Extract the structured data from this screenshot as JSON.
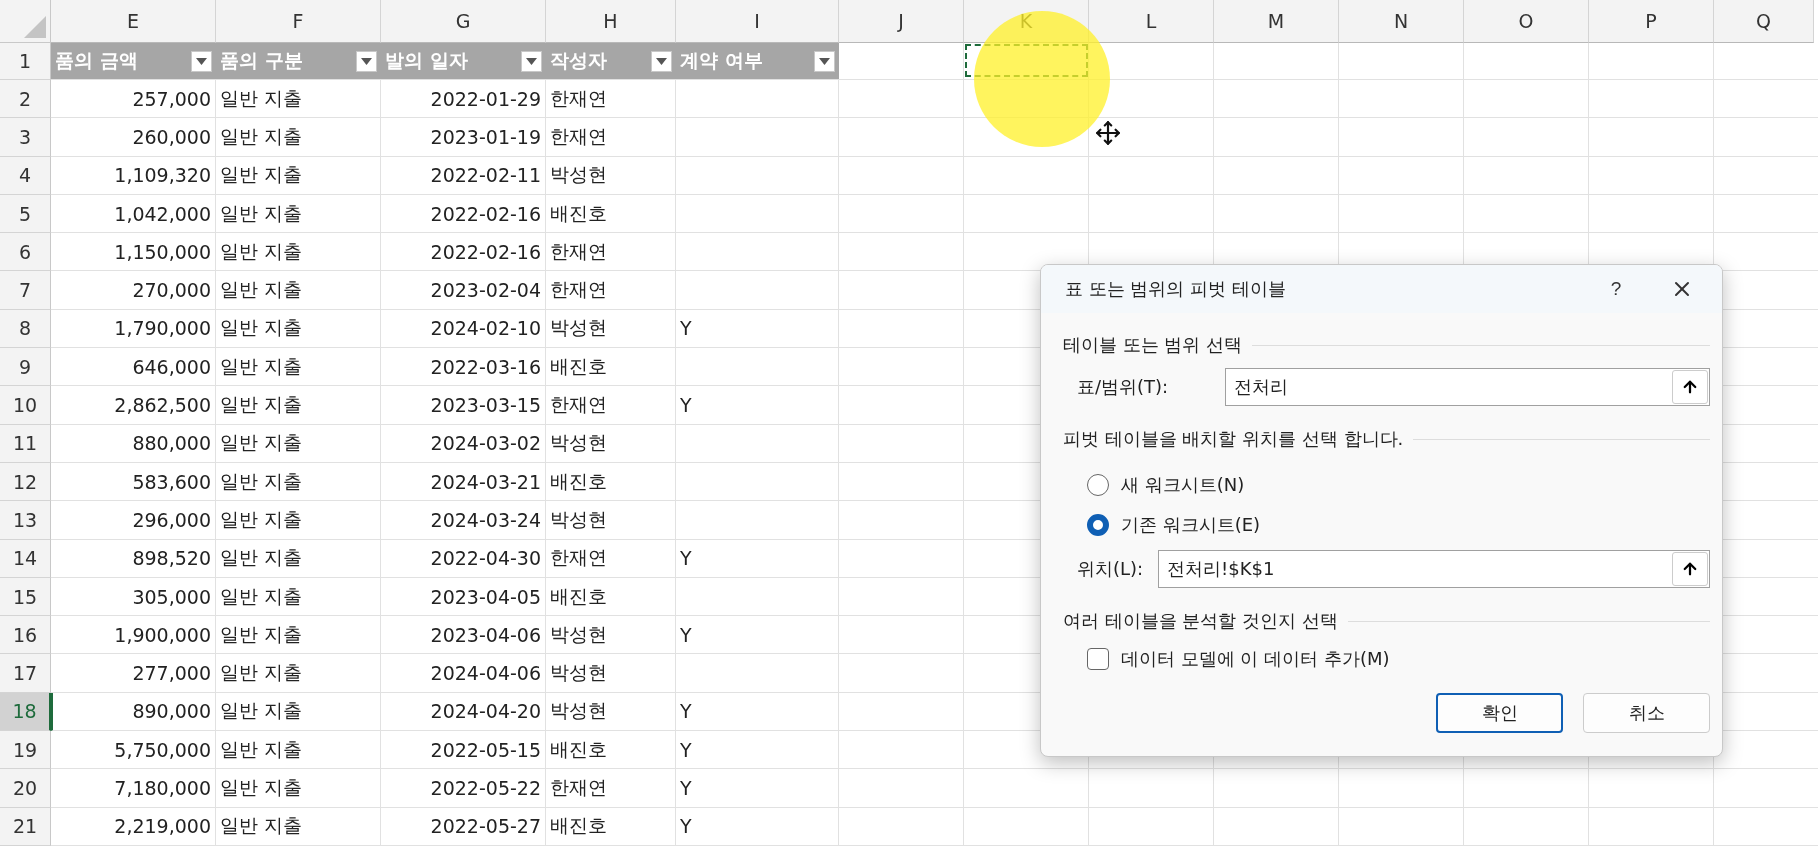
{
  "columns": [
    {
      "label": "E"
    },
    {
      "label": "F"
    },
    {
      "label": "G"
    },
    {
      "label": "H"
    },
    {
      "label": "I"
    },
    {
      "label": "J"
    },
    {
      "label": "K"
    },
    {
      "label": "L"
    },
    {
      "label": "M"
    },
    {
      "label": "N"
    },
    {
      "label": "O"
    },
    {
      "label": "P"
    },
    {
      "label": "Q"
    }
  ],
  "header_row": {
    "num": "1",
    "marquee": true,
    "headers": [
      "품의 금액",
      "품의 구분",
      "발의 일자",
      "작성자",
      "계약 여부"
    ]
  },
  "rows": [
    {
      "num": "2",
      "amount": "257,000",
      "category": "일반 지출",
      "date": "2022-01-29",
      "author": "한재연",
      "selected": false
    },
    {
      "num": "3",
      "amount": "260,000",
      "category": "일반 지출",
      "date": "2023-01-19",
      "author": "한재연",
      "selected": false
    },
    {
      "num": "4",
      "amount": "1,109,320",
      "category": "일반 지출",
      "date": "2022-02-11",
      "author": "박성현",
      "selected": false
    },
    {
      "num": "5",
      "amount": "1,042,000",
      "category": "일반 지출",
      "date": "2022-02-16",
      "author": "배진호",
      "selected": false
    },
    {
      "num": "6",
      "amount": "1,150,000",
      "category": "일반 지출",
      "date": "2022-02-16",
      "author": "한재연",
      "selected": false
    },
    {
      "num": "7",
      "amount": "270,000",
      "category": "일반 지출",
      "date": "2023-02-04",
      "author": "한재연",
      "selected": false
    },
    {
      "num": "8",
      "amount": "1,790,000",
      "category": "일반 지출",
      "date": "2024-02-10",
      "author": "박성현",
      "contract": "Y",
      "selected": false
    },
    {
      "num": "9",
      "amount": "646,000",
      "category": "일반 지출",
      "date": "2022-03-16",
      "author": "배진호",
      "selected": false
    },
    {
      "num": "10",
      "amount": "2,862,500",
      "category": "일반 지출",
      "date": "2023-03-15",
      "author": "한재연",
      "contract": "Y",
      "selected": false
    },
    {
      "num": "11",
      "amount": "880,000",
      "category": "일반 지출",
      "date": "2024-03-02",
      "author": "박성현",
      "selected": false
    },
    {
      "num": "12",
      "amount": "583,600",
      "category": "일반 지출",
      "date": "2024-03-21",
      "author": "배진호",
      "selected": false
    },
    {
      "num": "13",
      "amount": "296,000",
      "category": "일반 지출",
      "date": "2024-03-24",
      "author": "박성현",
      "selected": false
    },
    {
      "num": "14",
      "amount": "898,520",
      "category": "일반 지출",
      "date": "2022-04-30",
      "author": "한재연",
      "contract": "Y",
      "selected": false
    },
    {
      "num": "15",
      "amount": "305,000",
      "category": "일반 지출",
      "date": "2023-04-05",
      "author": "배진호",
      "selected": false
    },
    {
      "num": "16",
      "amount": "1,900,000",
      "category": "일반 지출",
      "date": "2023-04-06",
      "author": "박성현",
      "contract": "Y",
      "selected": false
    },
    {
      "num": "17",
      "amount": "277,000",
      "category": "일반 지출",
      "date": "2024-04-06",
      "author": "박성현",
      "selected": false
    },
    {
      "num": "18",
      "amount": "890,000",
      "category": "일반 지출",
      "date": "2024-04-20",
      "author": "박성현",
      "contract": "Y",
      "selected": true
    },
    {
      "num": "19",
      "amount": "5,750,000",
      "category": "일반 지출",
      "date": "2022-05-15",
      "author": "배진호",
      "contract": "Y",
      "selected": false
    },
    {
      "num": "20",
      "amount": "7,180,000",
      "category": "일반 지출",
      "date": "2022-05-22",
      "author": "한재연",
      "contract": "Y",
      "selected": false
    },
    {
      "num": "21",
      "amount": "2,219,000",
      "category": "일반 지출",
      "date": "2022-05-27",
      "author": "배진호",
      "contract": "Y",
      "selected": false
    }
  ],
  "dialog": {
    "title": "표 또는 범위의 피벗 테이블",
    "help": "?",
    "section_source": "테이블 또는 범위 선택",
    "range_field": {
      "label": "표/범위(T):",
      "value": "전처리"
    },
    "section_place": "피벗 테이블을 배치할 위치를 선택 합니다.",
    "placement_options": [
      {
        "label": "새 워크시트(N)",
        "selected": false
      },
      {
        "label": "기존 워크시트(E)",
        "selected": true
      }
    ],
    "location_field": {
      "label": "위치(L):",
      "value": "전처리!$K$1"
    },
    "section_multi": "여러 테이블을 분석할 것인지 선택",
    "data_model": {
      "label": "데이터 모델에 이 데이터 추가(M)",
      "checked": false
    },
    "buttons": [
      {
        "label": "확인",
        "kind": "default"
      },
      {
        "label": "취소",
        "kind": "normal"
      }
    ]
  }
}
